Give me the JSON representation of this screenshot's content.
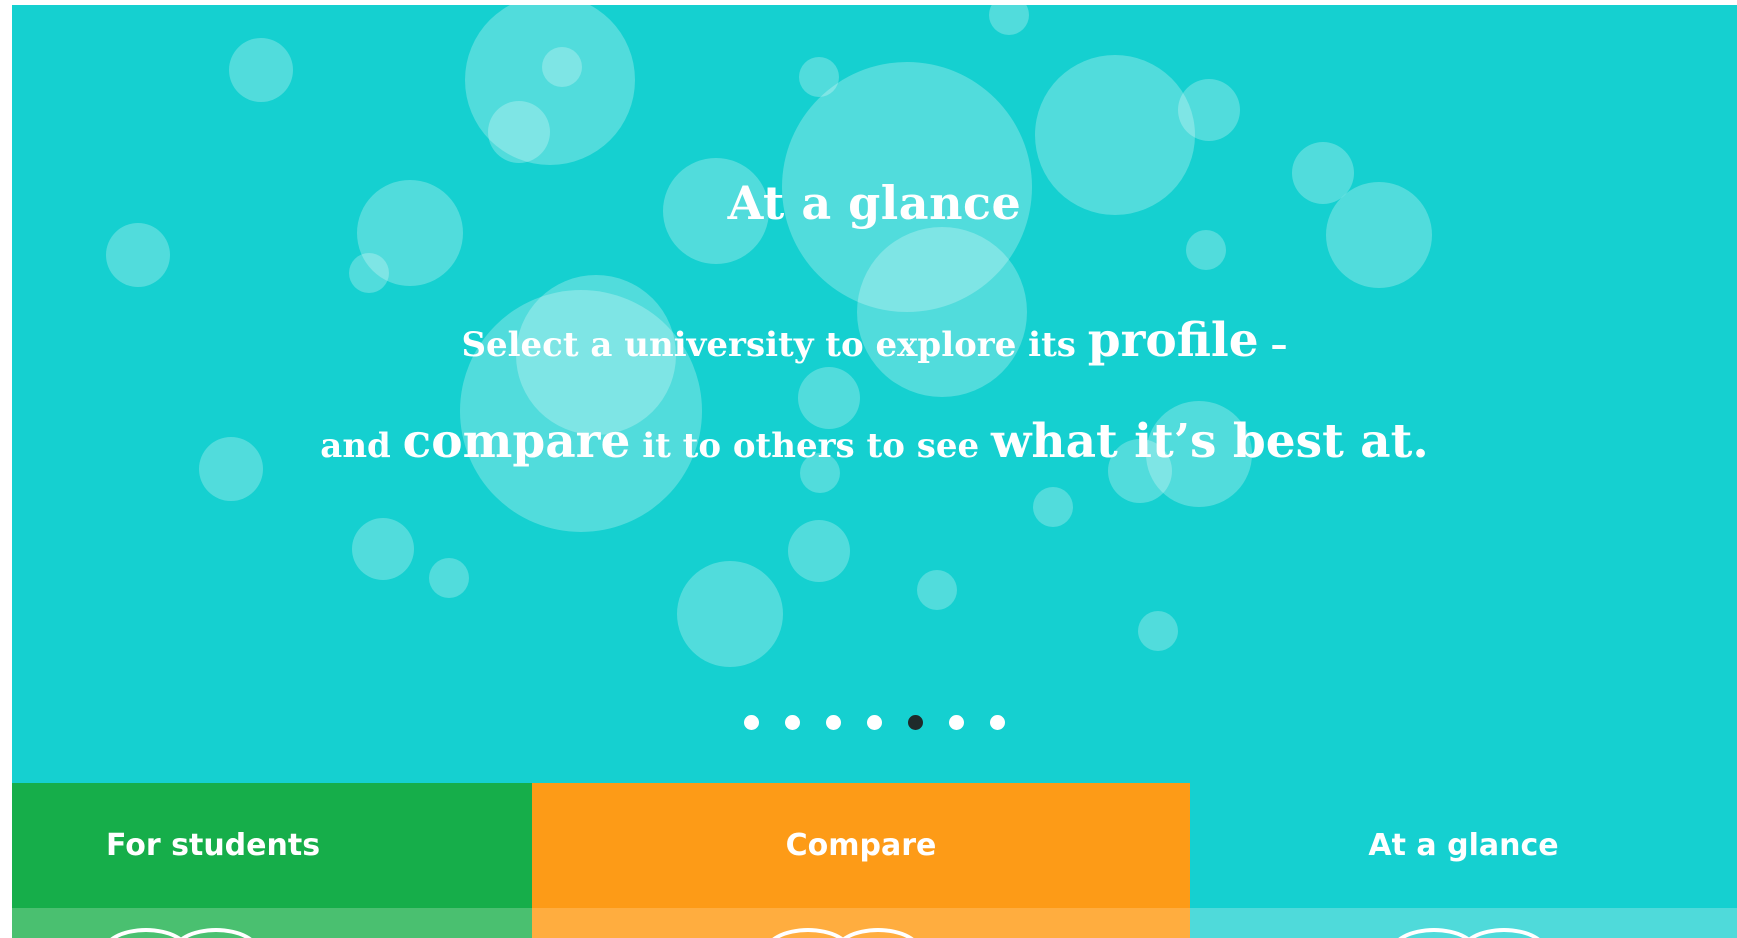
{
  "hero": {
    "title": "At a glance",
    "line1": {
      "part1": "Select a university to explore its ",
      "emph1": "profile",
      "part2": " –"
    },
    "line2": {
      "part1": "and ",
      "emph1": "compare",
      "part2": " it to others to see ",
      "emph2": "what it’s best at."
    },
    "background_color": "#15d0d0",
    "pagination": {
      "total": 7,
      "active_index": 4
    }
  },
  "tabs": [
    {
      "label": "For students",
      "color": "#16ae4a"
    },
    {
      "label": "Compare",
      "color": "#fd9b17"
    },
    {
      "label": "At a glance",
      "color": "#15d0d0"
    }
  ]
}
